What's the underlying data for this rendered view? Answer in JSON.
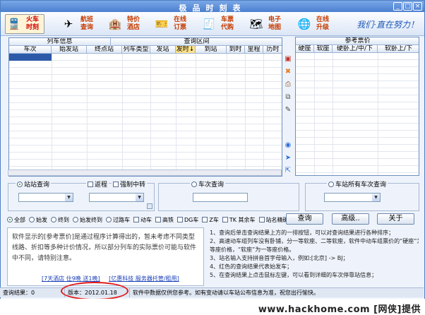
{
  "window": {
    "title": "极品时刻表",
    "controls": [
      "_",
      "□",
      "×"
    ]
  },
  "toolbar": {
    "buttons": [
      {
        "label": "火车\n时刻",
        "icon": "train-icon"
      },
      {
        "label": "航班\n查询",
        "icon": "airplane-icon"
      },
      {
        "label": "特价\n酒店",
        "icon": "hotel-icon"
      },
      {
        "label": "在线\n订票",
        "icon": "ticket-icon"
      },
      {
        "label": "车票\n代购",
        "icon": "purchase-icon"
      },
      {
        "label": "电子\n地图",
        "icon": "map-icon"
      },
      {
        "label": "在线\n升级",
        "icon": "upgrade-icon"
      }
    ],
    "slogan": "我们·直在努力！"
  },
  "grid": {
    "group_headers": [
      "列车信息",
      "查询区间",
      "参考票价"
    ],
    "columns": [
      "车次",
      "始发站",
      "终点站",
      "列车类型",
      "发站",
      "发时↓",
      "到站",
      "到时",
      "里程",
      "历时"
    ],
    "ref_columns": [
      "硬座",
      "软座",
      "硬卧上/中/下",
      "软卧上/下"
    ]
  },
  "query": {
    "station": {
      "label": "站站查询",
      "return_label": "返程",
      "transfer_label": "强制中转"
    },
    "train": {
      "label": "车次查询"
    },
    "all_trains": {
      "label": "车站所有车次查询"
    }
  },
  "filters": [
    "全部",
    "始发",
    "终到",
    "始发终到",
    "过路车",
    "动车",
    "高铁",
    "DG车",
    "Z车",
    "TK 其余车",
    "站名精确匹配"
  ],
  "buttons": {
    "query": "查询",
    "advanced": "高级..",
    "about": "关于"
  },
  "info": {
    "text": "软件显示的[参考票价]是通过程序计算得出的，暂未考虑不同类型线路、折扣等多种计价情况，所以部分列车的实际票价可能与软件中不同，请特别注意。",
    "link1": "[7天酒店 住9晚 送1晚]",
    "link2": "[亿惠科技 服务器托管/租用]"
  },
  "tips": [
    "1、查询后单击查询结果上方的一排按钮，可以对查询结果进行各种排序；",
    "2、高速动车组列车没有卧铺，分一等软座、二等软座，软件中动车组票价的“硬座”为二",
    "   等座价格，“软座”为一等座价格。",
    "3、站名输入支持拼音首字母输入，例如:[北京] -> BJ；",
    "4、红色的查询结果代表始发车；",
    "5、在查询结果上点击鼠标左键，可以看到详细的车次停靠站信息；"
  ],
  "status": {
    "result": "查询结果：0",
    "version": "版本：2012.01.18",
    "notice": "软件中数据仅供您参考。如有变动请以车站公布信息为准，祝您出行愉快。"
  },
  "watermark": "www.hackhome.com [网侠]提供",
  "colors": {
    "accent": "#4a7fd0",
    "selection": "#2c5aa8",
    "highlight": "#e21b1b"
  }
}
